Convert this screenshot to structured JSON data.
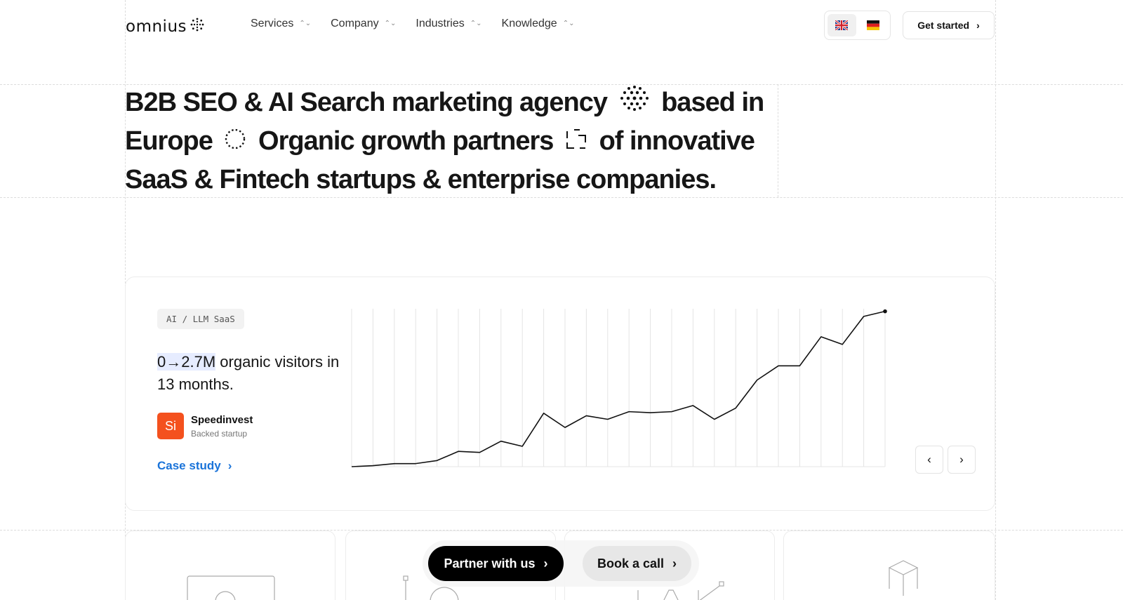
{
  "header": {
    "logo_text": "omnius",
    "nav": [
      {
        "label": "Services"
      },
      {
        "label": "Company"
      },
      {
        "label": "Industries"
      },
      {
        "label": "Knowledge"
      }
    ],
    "languages": [
      "uk-flag-icon",
      "de-flag-icon"
    ],
    "get_started": "Get started"
  },
  "hero": {
    "part1": "B2B SEO & AI Search marketing agency",
    "part2": "based in Europe",
    "part3": "Organic growth partners",
    "part4": "of innovative SaaS & Fintech startups & enterprise companies."
  },
  "case": {
    "tag": "AI / LLM SaaS",
    "metric": "0→2.7M",
    "headline_rest": " organic visitors in 13 months.",
    "company_logo": "Si",
    "company_name": "Speedinvest",
    "company_sub": "Backed startup",
    "link": "Case study",
    "logo_color": "#f4511e",
    "link_color": "#1a73d9"
  },
  "chart_data": {
    "type": "line",
    "series": [
      {
        "values": [
          0,
          0.02,
          0.06,
          0.06,
          0.12,
          0.3,
          0.28,
          0.5,
          0.4,
          1.05,
          0.77,
          1.0,
          0.93,
          1.08,
          1.06,
          1.08,
          1.2,
          0.93,
          1.15,
          1.7,
          1.98,
          1.98,
          2.55,
          2.4,
          2.95,
          3.05
        ]
      }
    ],
    "ylim": [
      0,
      3.1
    ],
    "grid": "vertical"
  },
  "cta": {
    "primary": "Partner with us",
    "secondary": "Book a call"
  }
}
